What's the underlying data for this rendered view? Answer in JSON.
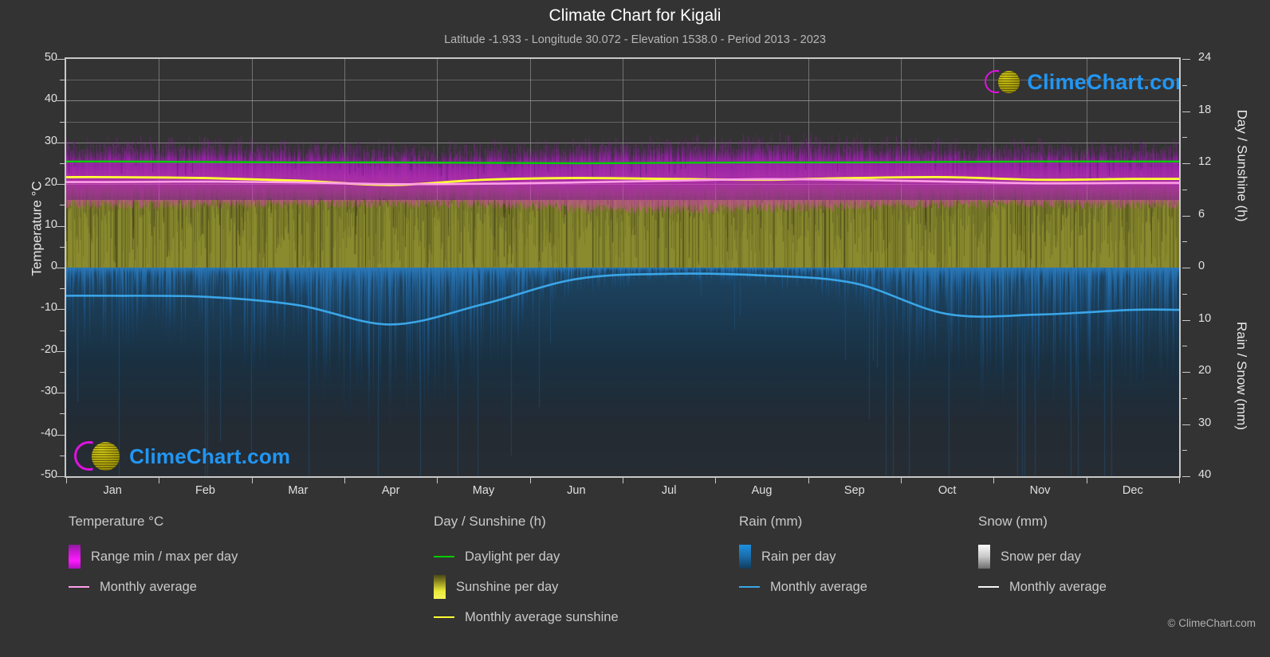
{
  "header": {
    "title": "Climate Chart for Kigali",
    "subtitle": "Latitude -1.933 - Longitude 30.072 - Elevation 1538.0 - Period 2013 - 2023"
  },
  "axes": {
    "left_label": "Temperature °C",
    "right_upper_label": "Day / Sunshine (h)",
    "right_lower_label": "Rain / Snow (mm)",
    "left_ticks": [
      "50",
      "40",
      "30",
      "20",
      "10",
      "0",
      "-10",
      "-20",
      "-30",
      "-40",
      "-50"
    ],
    "right_upper_ticks": [
      "24",
      "18",
      "12",
      "6",
      "0"
    ],
    "right_lower_ticks": [
      "0",
      "10",
      "20",
      "30",
      "40"
    ],
    "x_ticks": [
      "Jan",
      "Feb",
      "Mar",
      "Apr",
      "May",
      "Jun",
      "Jul",
      "Aug",
      "Sep",
      "Oct",
      "Nov",
      "Dec"
    ]
  },
  "watermark": {
    "text": "ClimeChart.com"
  },
  "legend": {
    "temperature": {
      "title": "Temperature °C",
      "items": [
        {
          "label": "Range min / max per day",
          "marker": "swatch",
          "color": "#e612e6"
        },
        {
          "label": "Monthly average",
          "marker": "line",
          "color": "#ff9ee8"
        }
      ]
    },
    "daysunshine": {
      "title": "Day / Sunshine (h)",
      "items": [
        {
          "label": "Daylight per day",
          "marker": "line",
          "color": "#00cc00"
        },
        {
          "label": "Sunshine per day",
          "marker": "swatch",
          "color": "#e8e82a"
        },
        {
          "label": "Monthly average sunshine",
          "marker": "line",
          "color": "#ffff33"
        }
      ]
    },
    "rain": {
      "title": "Rain (mm)",
      "items": [
        {
          "label": "Rain per day",
          "marker": "swatch",
          "color": "#1e90e0"
        },
        {
          "label": "Monthly average",
          "marker": "line",
          "color": "#3aa6e8"
        }
      ]
    },
    "snow": {
      "title": "Snow (mm)",
      "items": [
        {
          "label": "Snow per day",
          "marker": "swatch",
          "color": "#f0f0f0"
        },
        {
          "label": "Monthly average",
          "marker": "line",
          "color": "#f5f5f5"
        }
      ]
    }
  },
  "copyright": "© ClimeChart.com",
  "colors": {
    "background": "#333333",
    "grid": "#8f8f8f",
    "axis": "#c8c8c8",
    "text": "#e0e0e0",
    "temp_range": "#cc22cc",
    "temp_avg": "#ff9ee8",
    "daylight": "#00cc00",
    "sunshine_area": "#8a8a2e",
    "sunshine_avg": "#ffff33",
    "rain_area": "#1e6fa8",
    "rain_avg": "#3aa6e8",
    "watermark_text": "#2196f3",
    "watermark_ring": "#e012e0",
    "watermark_ball": "#d8d22a"
  },
  "chart_data": {
    "type": "line",
    "title": "Climate Chart for Kigali",
    "subtitle": "Latitude -1.933 - Longitude 30.072 - Elevation 1538.0 - Period 2013 - 2023",
    "xlabel": "",
    "ylabel": "Temperature °C",
    "ylim": [
      -50,
      50
    ],
    "y2_upper_label": "Day / Sunshine (h)",
    "y2_upper_lim": [
      0,
      24
    ],
    "y2_lower_label": "Rain / Snow (mm)",
    "y2_lower_lim": [
      0,
      40
    ],
    "grid": true,
    "legend_position": "below",
    "categories": [
      "Jan",
      "Feb",
      "Mar",
      "Apr",
      "May",
      "Jun",
      "Jul",
      "Aug",
      "Sep",
      "Oct",
      "Nov",
      "Dec"
    ],
    "series": [
      {
        "name": "Monthly average temperature (°C)",
        "unit": "°C",
        "color": "#ff9ee8",
        "values": [
          20.5,
          20.6,
          20.4,
          20.0,
          20.1,
          20.4,
          20.8,
          21.2,
          21.0,
          20.6,
          20.2,
          20.3
        ]
      },
      {
        "name": "Daily temperature range max (°C)",
        "unit": "°C",
        "color": "#cc22cc",
        "values": [
          27.5,
          27.6,
          27.2,
          26.5,
          26.6,
          27.3,
          28.0,
          28.4,
          28.0,
          27.2,
          26.8,
          27.0
        ]
      },
      {
        "name": "Daily temperature range min (°C)",
        "unit": "°C",
        "color": "#cc22cc",
        "values": [
          15.0,
          15.2,
          15.3,
          15.4,
          15.2,
          14.2,
          13.8,
          14.2,
          14.8,
          15.2,
          15.2,
          15.0
        ]
      },
      {
        "name": "Daylight per day (h)",
        "unit": "h",
        "color": "#00cc00",
        "values": [
          12.2,
          12.15,
          12.1,
          12.1,
          12.05,
          12.0,
          12.05,
          12.1,
          12.1,
          12.15,
          12.2,
          12.2
        ]
      },
      {
        "name": "Monthly average sunshine (h)",
        "unit": "h",
        "color": "#ffff33",
        "values": [
          10.4,
          10.3,
          10.0,
          9.5,
          10.1,
          10.3,
          10.2,
          10.1,
          10.3,
          10.4,
          10.1,
          10.2
        ]
      },
      {
        "name": "Sunshine per day area top (h)",
        "unit": "h",
        "color": "#8a8a2e",
        "values": [
          7.8,
          7.8,
          7.7,
          7.6,
          7.7,
          7.8,
          7.9,
          7.9,
          7.8,
          7.7,
          7.7,
          7.8
        ]
      },
      {
        "name": "Monthly average rain (mm)",
        "unit": "mm",
        "color": "#3aa6e8",
        "values": [
          5.4,
          5.6,
          7.2,
          10.9,
          7.0,
          2.2,
          1.2,
          1.5,
          3.0,
          8.9,
          9.0,
          8.1
        ]
      },
      {
        "name": "Monthly average snow (mm)",
        "unit": "mm",
        "color": "#f5f5f5",
        "values": [
          0,
          0,
          0,
          0,
          0,
          0,
          0,
          0,
          0,
          0,
          0,
          0
        ]
      }
    ]
  }
}
